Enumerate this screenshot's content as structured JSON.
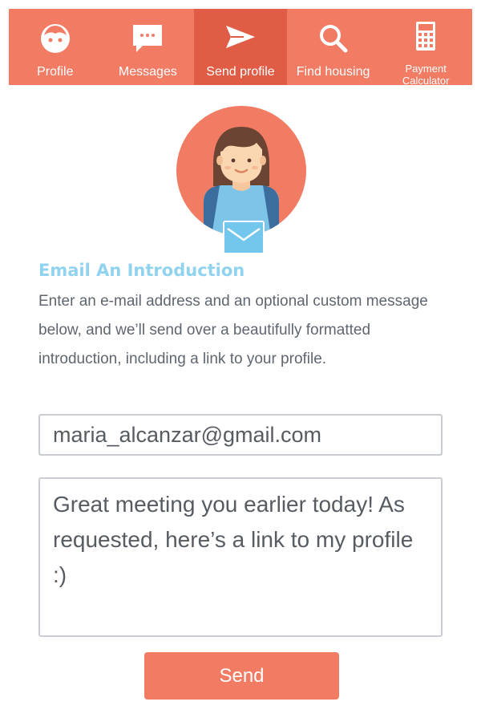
{
  "nav": {
    "items": [
      {
        "label": "Profile",
        "icon": "profile-face-icon",
        "active": false
      },
      {
        "label": "Messages",
        "icon": "chat-bubble-icon",
        "active": false
      },
      {
        "label": "Send profile",
        "icon": "paper-plane-icon",
        "active": true
      },
      {
        "label": "Find housing",
        "icon": "search-icon",
        "active": false
      },
      {
        "label_line1": "Payment",
        "label_line2": "Calculator",
        "icon": "calculator-icon",
        "active": false
      }
    ]
  },
  "avatar": {
    "icon": "user-avatar-icon",
    "badge_icon": "envelope-icon"
  },
  "intro": {
    "title": "Email An Introduction",
    "description": "Enter an e-mail address and an optional custom message below, and we’ll send over a beautifully formatted introduction, including a link to your profile."
  },
  "form": {
    "email_value": "maria_alcanzar@gmail.com",
    "message_value": "Great meeting you earlier today! As requested, here’s a link to my profile :)",
    "send_label": "Send"
  },
  "colors": {
    "brand": "#F27B63",
    "brand_active": "#E05C44",
    "title_blue": "#8FD3F0",
    "badge_blue": "#73C6EC",
    "text_gray": "#5F6670"
  }
}
